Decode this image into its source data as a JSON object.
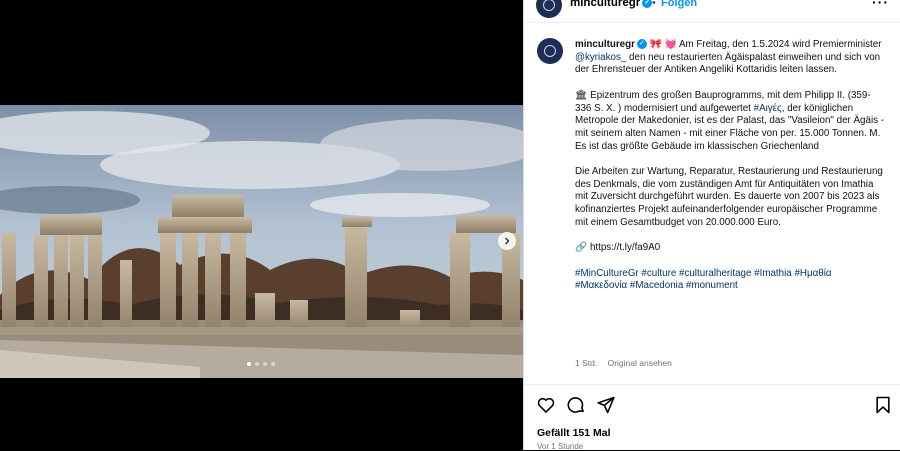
{
  "header": {
    "username": "minculturegr",
    "separator": "•",
    "follow_label": "Folgen",
    "more_icon": "more-horizontal-icon"
  },
  "caption": {
    "username": "minculturegr",
    "emojis": "🎀 💓",
    "p1_before": "Am Freitag, den 1.5.2024 wird Premierminister ",
    "mention": "@kyriakos_",
    "p1_after": " den neu restaurierten Ägäispalast einweihen und sich von der Ehrensteuer der Antiken Angeliki Kottaridis leiten lassen.",
    "p2_emoji": "🏛",
    "p2_before": " Epizentrum des großen Bauprogramms, mit dem Philipp II. (359-336 S. X. ) modernisiert und aufgewertet ",
    "p2_tag": "#Αιγές",
    "p2_after": ", der königlichen Metropole der Makedonier, ist es der Palast, das \"Vasileion\" der Ägäis - mit seinem alten Namen - mit einer Fläche von per. 15.000 Tonnen. M. Es ist das größte Gebäude im klassischen Griechenland",
    "p3": "Die Arbeiten zur Wartung, Reparatur, Restaurierung und Restaurierung des Denkmals, die vom zuständigen Amt für Antiquitäten von Imathia mit Zuversicht durchgeführt wurden. Es dauerte von 2007 bis 2023 als kofinanziertes Projekt aufeinanderfolgender europäischer Programme mit einem Gesamtbudget von 20.000.000 Euro.",
    "link_emoji": "🔗",
    "link": "https://t.ly/fa9A0",
    "hashtags": "#MinCultureGr #culture #culturalheritage #Imathia #Ημαθία #Μακεδονία #Macedonia #monument"
  },
  "meta": {
    "time": "1 Std.",
    "original": "Original ansehen"
  },
  "actions": {
    "likes": "Gefällt 151 Mal",
    "ago": "Vor 1 Stunde"
  },
  "media": {
    "slide_count": 4,
    "active_slide": 1
  },
  "colors": {
    "accent": "#0095f6",
    "link": "#00376b",
    "muted": "#737373",
    "avatar": "#1d2d55"
  }
}
